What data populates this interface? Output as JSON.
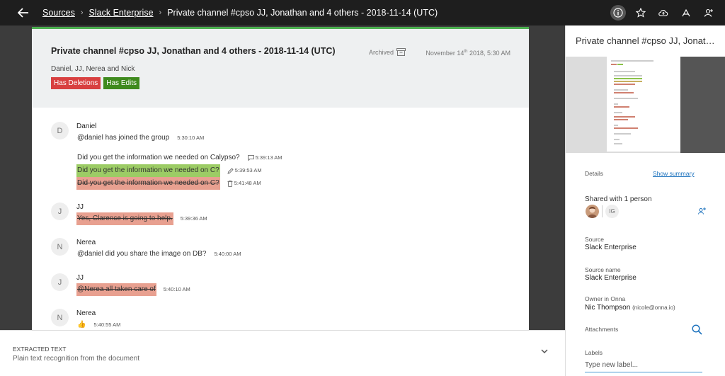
{
  "topbar": {
    "crumbs": [
      "Sources",
      "Slack Enterprise"
    ],
    "current": "Private channel #cpso JJ, Jonathan and 4 others - 2018-11-14 (UTC)",
    "icons": [
      "info-icon",
      "star-icon",
      "cloud-upload-icon",
      "acrobat-icon",
      "add-user-icon"
    ]
  },
  "doc": {
    "title": "Private channel #cpso JJ, Jonathan and 4 others - 2018-11-14 (UTC)",
    "archived_label": "Archived",
    "date_prefix": "November 14",
    "date_sup": "th",
    "date_suffix": " 2018, 5:30 AM",
    "people": "Daniel, JJ, Nerea and Nick",
    "tags": {
      "deletions": "Has Deletions",
      "edits": "Has Edits"
    },
    "accent_colors": {
      "top_border": "#4caf50",
      "deletion": "#d84040",
      "edit": "#3f8a1e",
      "edited_highlight": "#9ccc65",
      "deleted_highlight": "#e8a090"
    }
  },
  "messages": {
    "m1": {
      "initial": "D",
      "name": "Daniel",
      "text": "@daniel has joined the group",
      "time": "5:30:10 AM"
    },
    "m1b": {
      "text": "Did you get the information we needed on Calypso?",
      "time": "5:39:13 AM"
    },
    "m1c": {
      "text": "Did you get the information we needed on C?",
      "time": "5:39:53 AM"
    },
    "m1d": {
      "text": "Did you get the information we needed on C?",
      "time": "5:41:48 AM"
    },
    "m2": {
      "initial": "J",
      "name": "JJ",
      "text": "Yes, Clarence is going to help.",
      "time": "5:39:36 AM"
    },
    "m3": {
      "initial": "N",
      "name": "Nerea",
      "text": "@daniel did you share the image on DB?",
      "time": "5:40:00 AM"
    },
    "m4": {
      "initial": "J",
      "name": "JJ",
      "text": "@Nerea all taken care of",
      "time": "5:40:10 AM"
    },
    "m5": {
      "initial": "N",
      "name": "Nerea",
      "text": "👍",
      "time": "5:40:55 AM"
    }
  },
  "extracted": {
    "title": "EXTRACTED TEXT",
    "subtitle": "Plain text recognition from the document"
  },
  "panel": {
    "title": "Private channel #cpso JJ, Jonathan and 4 others - 2018-11-14 (UTC)",
    "details_label": "Details",
    "show_summary": "Show summary",
    "shared_with": "Shared with 1 person",
    "shared_initials": "IG",
    "source_label": "Source",
    "source_value": "Slack Enterprise",
    "source_name_label": "Source name",
    "source_name_value": "Slack Enterprise",
    "owner_label": "Owner in Onna",
    "owner_name": "Nic Thompson",
    "owner_email": "(nicole@onna.io)",
    "attachments_label": "Attachments",
    "labels_label": "Labels",
    "labels_placeholder": "Type new label..."
  }
}
